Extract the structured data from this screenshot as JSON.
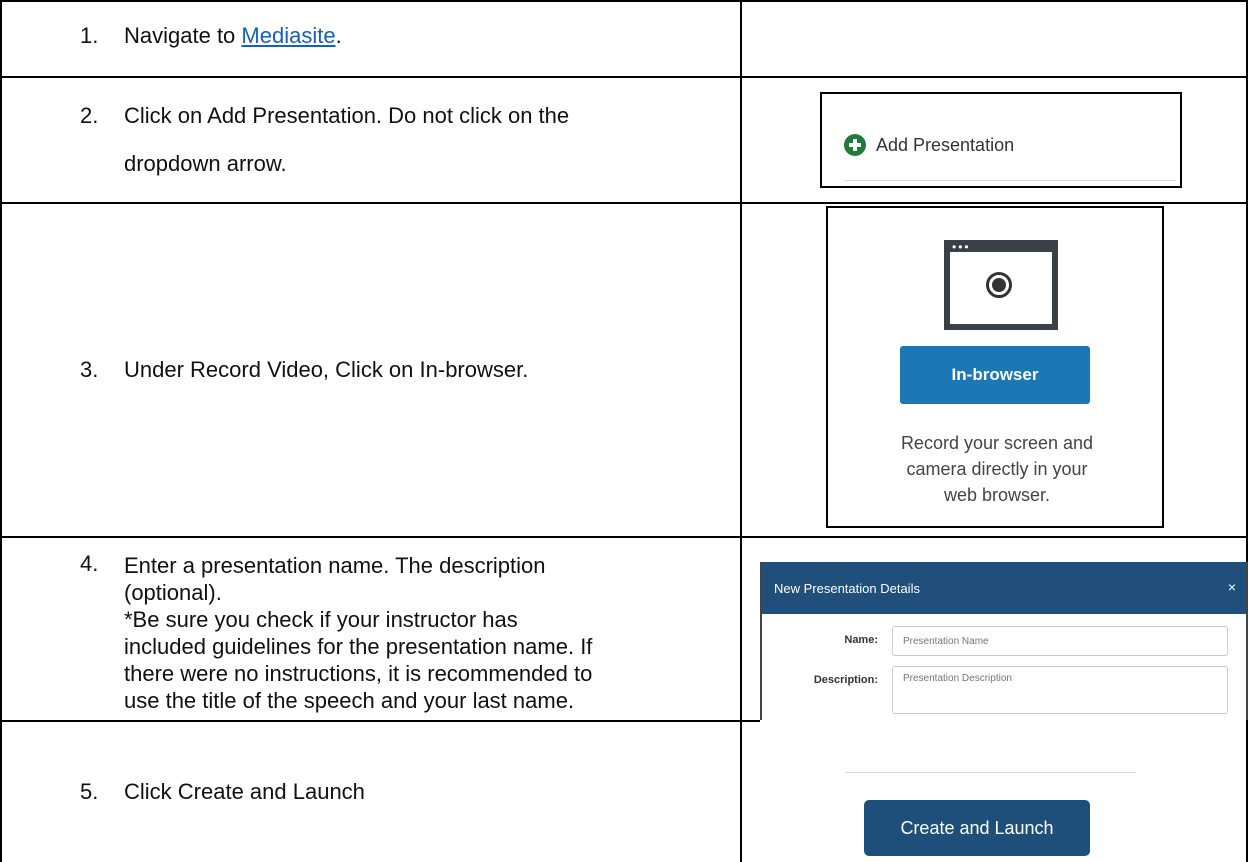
{
  "steps": [
    {
      "num": "1.",
      "pre": "Navigate to ",
      "link": "Mediasite",
      "post": "."
    },
    {
      "num": "2.",
      "line1": "Click on Add Presentation. Do not click on the",
      "line2": "dropdown arrow."
    },
    {
      "num": "3.",
      "text": "Under Record Video, Click on In-browser."
    },
    {
      "num": "4.",
      "lines": [
        "Enter a presentation name. The description",
        "(optional).",
        "*Be sure you check if your instructor has",
        "included guidelines for the presentation name. If",
        "there were no instructions, it is recommended to",
        "use the title of the speech and your last name."
      ]
    },
    {
      "num": "5.",
      "text": "Click Create and Launch"
    }
  ],
  "add_presentation": {
    "icon": "plus-circle-icon",
    "label": "Add Presentation",
    "icon_color": "#1f7a3c"
  },
  "in_browser": {
    "icon": "browser-record-icon",
    "button_label": "In-browser",
    "button_color": "#1b78b4",
    "desc_lines": [
      "Record your screen and",
      "camera directly in your",
      "web browser."
    ]
  },
  "dialog": {
    "title": "New Presentation Details",
    "close_glyph": "×",
    "header_color": "#1f4f7a",
    "name_label": "Name:",
    "name_placeholder": "Presentation Name",
    "desc_label": "Description:",
    "desc_placeholder": "Presentation Description"
  },
  "create": {
    "button_label": "Create and Launch",
    "button_color": "#1e4f7b"
  }
}
